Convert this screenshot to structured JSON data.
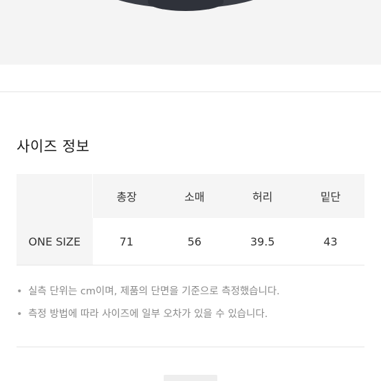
{
  "size_info": {
    "title": "사이즈 정보",
    "columns": [
      "",
      "총장",
      "소매",
      "허리",
      "밑단"
    ],
    "rows": [
      {
        "size": "ONE SIZE",
        "values": [
          "71",
          "56",
          "39.5",
          "43"
        ]
      }
    ]
  },
  "notes": [
    "실측 단위는 cm이며, 제품의 단면을 기준으로 측정했습니다.",
    "측정 방법에 따라 사이즈에 일부 오차가 있을 수 있습니다."
  ],
  "bullet": "•"
}
